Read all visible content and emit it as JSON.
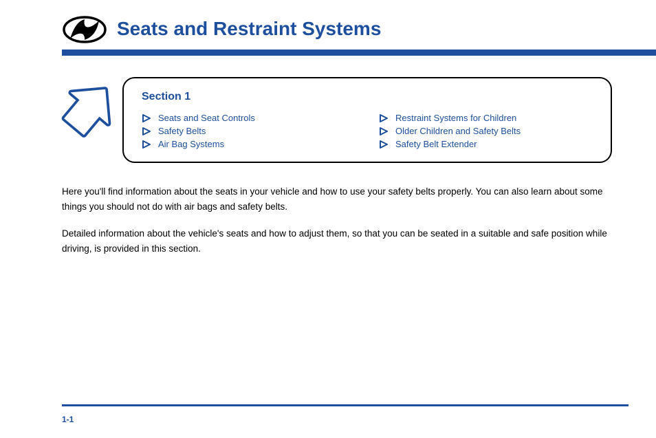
{
  "brand_color": "#1d4f9e",
  "section_title": "Seats and Restraint Systems",
  "callout": {
    "title": "Section 1",
    "left_links": [
      "Seats and Seat Controls",
      "Safety Belts",
      "Air Bag Systems"
    ],
    "right_links": [
      "Restraint Systems for Children",
      "Older Children and Safety Belts",
      "Safety Belt Extender"
    ]
  },
  "body_paragraphs": [
    "Here you'll find information about the seats in your vehicle and how to use your safety belts properly. You can also learn about some things you should not do with air bags and safety belts.",
    "Detailed information about the vehicle's seats and how to adjust them, so that you can be seated in a suitable and safe position while driving, is provided in this section."
  ],
  "page_number": "1-1"
}
